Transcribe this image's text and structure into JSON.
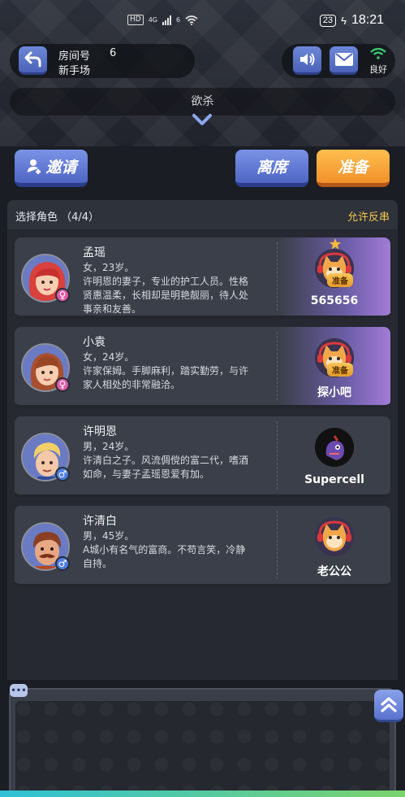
{
  "status_bar": {
    "hd": "HD",
    "network": "4G",
    "wifi_badge": "6",
    "battery": "23",
    "time": "18:21"
  },
  "room": {
    "label": "房间号",
    "number": "6",
    "mode": "新手场"
  },
  "toolbar": {
    "wifi_status": "良好"
  },
  "title": "欲杀",
  "actions": {
    "invite": "邀请",
    "leave": "离席",
    "ready": "准备"
  },
  "roles_panel": {
    "title": "选择角色 （4/4）",
    "toggle": "允许反串"
  },
  "roles": [
    {
      "name": "孟瑶",
      "meta": "女，23岁。",
      "desc": "许明恩的妻子，专业的护工人员。性格贤惠温柔，长相却是明艳靓丽，待人处事亲和友善。",
      "gender": "female",
      "player": "565656",
      "ready_tag": "准备",
      "is_ready": true
    },
    {
      "name": "小袁",
      "meta": "女，24岁。",
      "desc": "许家保姆。手脚麻利，踏实勤劳，与许家人相处的非常融洽。",
      "gender": "female",
      "player": "探小吧",
      "ready_tag": "准备",
      "is_ready": true
    },
    {
      "name": "许明恩",
      "meta": "男，24岁。",
      "desc": "许清白之子。风流倜傥的富二代，嗜酒如命，与妻子孟瑶恩爱有加。",
      "gender": "male",
      "player": "Supercell",
      "ready_tag": "",
      "is_ready": false
    },
    {
      "name": "许清白",
      "meta": "男，45岁。",
      "desc": "A城小有名气的富商。不苟言笑，冷静自持。",
      "gender": "male",
      "player": "老公公",
      "ready_tag": "",
      "is_ready": false
    }
  ],
  "colors": {
    "accent_blue": "#5a72ce",
    "accent_orange": "#f2902a",
    "toggle_yellow": "#f3c64a",
    "ready_purple": "#a37bd6"
  }
}
